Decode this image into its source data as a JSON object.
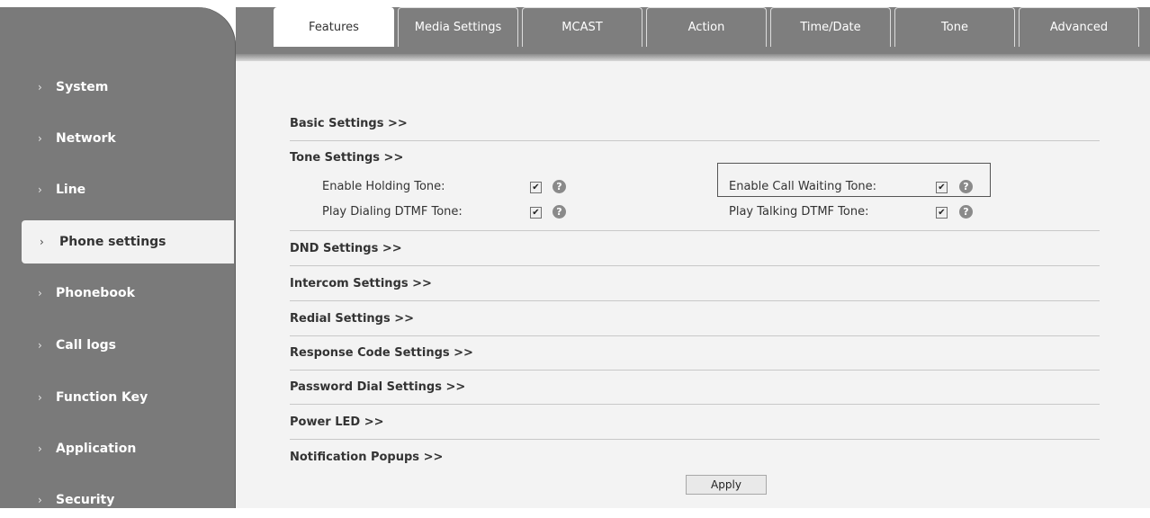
{
  "tabs": [
    {
      "label": "Features",
      "active": true
    },
    {
      "label": "Media Settings",
      "active": false
    },
    {
      "label": "MCAST",
      "active": false
    },
    {
      "label": "Action",
      "active": false
    },
    {
      "label": "Time/Date",
      "active": false
    },
    {
      "label": "Tone",
      "active": false
    },
    {
      "label": "Advanced",
      "active": false
    }
  ],
  "sidebar": {
    "items": [
      {
        "label": "System"
      },
      {
        "label": "Network"
      },
      {
        "label": "Line"
      },
      {
        "label": "Phone settings",
        "active": true
      },
      {
        "label": "Phonebook"
      },
      {
        "label": "Call logs"
      },
      {
        "label": "Function Key"
      },
      {
        "label": "Application"
      },
      {
        "label": "Security"
      }
    ],
    "chevron": "›"
  },
  "sections": {
    "basic": "Basic Settings >>",
    "tone": "Tone Settings >>",
    "dnd": "DND Settings >>",
    "intercom": "Intercom Settings >>",
    "redial": "Redial Settings >>",
    "response": "Response Code Settings >>",
    "password": "Password Dial Settings >>",
    "powerled": "Power LED >>",
    "notification": "Notification Popups >>"
  },
  "tone_options": {
    "holding": {
      "label": "Enable Holding Tone:",
      "checked": true
    },
    "call_waiting": {
      "label": "Enable Call Waiting Tone:",
      "checked": true
    },
    "dialing_dtmf": {
      "label": "Play Dialing DTMF Tone:",
      "checked": true
    },
    "talking_dtmf": {
      "label": "Play Talking DTMF Tone:",
      "checked": true
    }
  },
  "apply_label": "Apply",
  "icons": {
    "check": "✔",
    "help": "?"
  },
  "colors": {
    "sidebar": "#7a7a7a",
    "content_bg": "#f3f3f3",
    "active_bg": "#f2f2f2"
  }
}
